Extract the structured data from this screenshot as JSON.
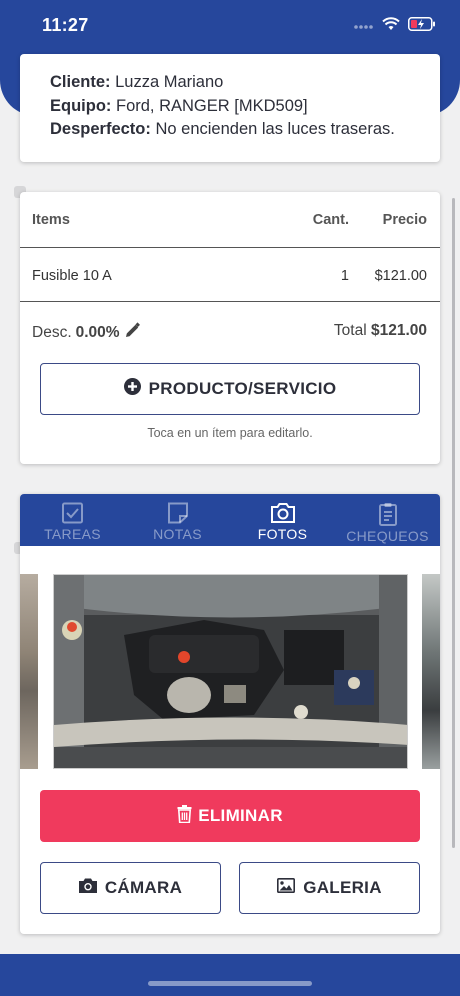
{
  "status": {
    "time": "11:27"
  },
  "info": {
    "client_label": "Cliente:",
    "client_value": "Luzza Mariano",
    "equipment_label": "Equipo:",
    "equipment_value": "Ford, RANGER [MKD509]",
    "issue_label": "Desperfecto:",
    "issue_value": "No encienden las luces traseras."
  },
  "items": {
    "headers": [
      "Items",
      "Cant.",
      "Precio"
    ],
    "rows": [
      {
        "name": "Fusible 10 A",
        "qty": "1",
        "price": "$121.00"
      }
    ],
    "discount_label": "Desc.",
    "discount_value": "0.00%",
    "total_label": "Total",
    "total_value": "$121.00",
    "add_button": "PRODUCTO/SERVICIO",
    "hint": "Toca en un ítem para editarlo."
  },
  "tabs": [
    {
      "label": "TAREAS",
      "icon": "checkbox-icon",
      "active": false
    },
    {
      "label": "NOTAS",
      "icon": "note-icon",
      "active": false
    },
    {
      "label": "FOTOS",
      "icon": "camera-icon",
      "active": true
    },
    {
      "label": "CHEQUEOS",
      "icon": "clipboard-icon",
      "active": false
    }
  ],
  "photos": {
    "delete_button": "ELIMINAR",
    "camera_button": "CÁMARA",
    "gallery_button": "GALERIA"
  },
  "colors": {
    "primary": "#26479c",
    "danger": "#f03a5d",
    "outline": "#3b4a86"
  }
}
